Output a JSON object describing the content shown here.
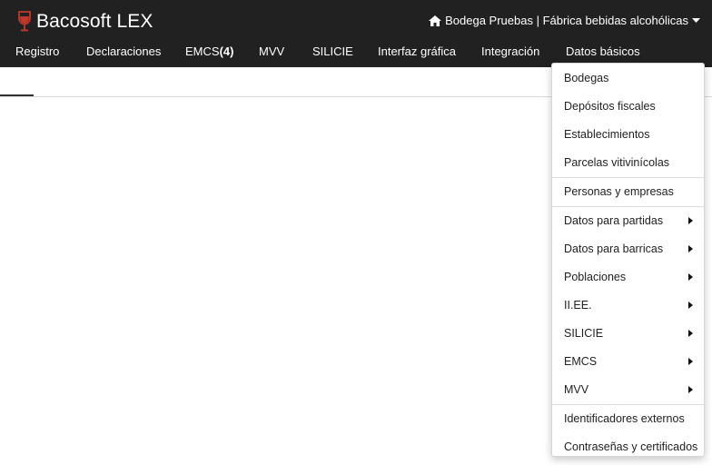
{
  "brand": {
    "name": "Bacosoft LEX",
    "accent_color": "#c0392b"
  },
  "header": {
    "bodega_label": "Bodega Pruebas | Fábrica bebidas alcohólicas",
    "home_icon": "home-icon",
    "caret_icon": "caret-down-icon"
  },
  "menu": {
    "registro": "Registro",
    "declaraciones": "Declaraciones",
    "emcs_label": "EMCS",
    "emcs_count": "(4)",
    "mvv": "MVV",
    "silicie": "SILICIE",
    "interfaz": "Interfaz gráfica",
    "integracion": "Integración",
    "datos_basicos": "Datos básicos"
  },
  "dropdown": {
    "group1": [
      "Bodegas",
      "Depósitos fiscales",
      "Establecimientos",
      "Parcelas vitivinícolas"
    ],
    "group2": [
      "Personas y empresas"
    ],
    "group3": [
      "Datos para partidas",
      "Datos para barricas",
      "Poblaciones",
      "II.EE.",
      "SILICIE",
      "EMCS",
      "MVV"
    ],
    "group4": [
      "Identificadores externos",
      "Contraseñas y certificados"
    ]
  }
}
